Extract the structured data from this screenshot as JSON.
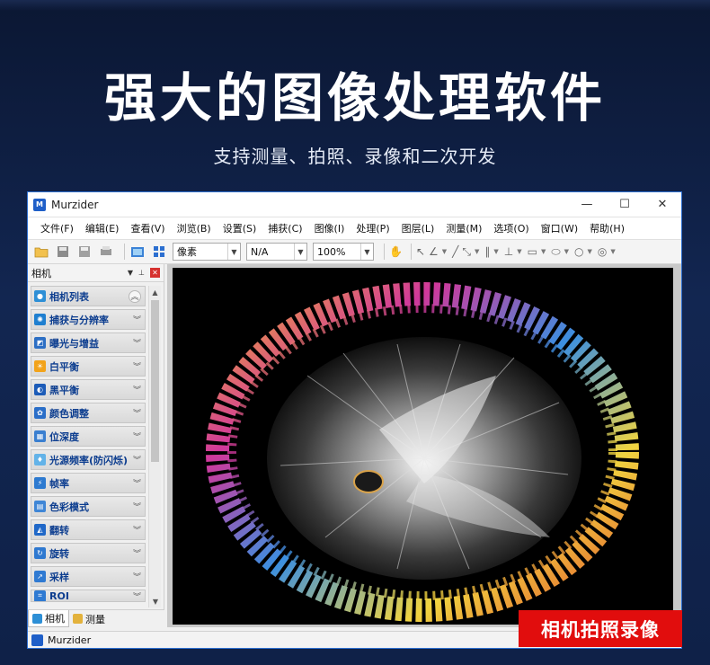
{
  "hero": {
    "title": "强大的图像处理软件",
    "subtitle": "支持测量、拍照、录像和二次开发"
  },
  "window": {
    "title": "Murzider",
    "controls": [
      "—",
      "☐",
      "✕"
    ]
  },
  "menu": [
    "文件(F)",
    "编辑(E)",
    "查看(V)",
    "浏览(B)",
    "设置(S)",
    "捕获(C)",
    "图像(I)",
    "处理(P)",
    "图层(L)",
    "测量(M)",
    "选项(O)",
    "窗口(W)",
    "帮助(H)"
  ],
  "toolbar": {
    "unit_select": "像素",
    "value_select": "N/A",
    "zoom_select": "100%"
  },
  "panel": {
    "title": "相机",
    "items": [
      {
        "label": "相机列表",
        "icon": "camera-icon",
        "color": "#2d8fd6"
      },
      {
        "label": "捕获与分辨率",
        "icon": "aperture-icon",
        "color": "#1e7fd0"
      },
      {
        "label": "曝光与增益",
        "icon": "exposure-icon",
        "color": "#2d6fc4"
      },
      {
        "label": "白平衡",
        "icon": "sun-icon",
        "color": "#f2a31b"
      },
      {
        "label": "黑平衡",
        "icon": "contrast-icon",
        "color": "#1d5cb8"
      },
      {
        "label": "颜色调整",
        "icon": "palette-icon",
        "color": "#2a6ec8"
      },
      {
        "label": "位深度",
        "icon": "bit-depth-icon",
        "color": "#3a7fd0"
      },
      {
        "label": "光源频率(防闪烁)",
        "icon": "bulb-icon",
        "color": "#63b3e8"
      },
      {
        "label": "帧率",
        "icon": "frame-rate-icon",
        "color": "#2d7ad0"
      },
      {
        "label": "色彩模式",
        "icon": "color-mode-icon",
        "color": "#3f86d6"
      },
      {
        "label": "翻转",
        "icon": "flip-icon",
        "color": "#2068c8"
      },
      {
        "label": "旋转",
        "icon": "rotate-icon",
        "color": "#2f79d0"
      },
      {
        "label": "采样",
        "icon": "sampling-icon",
        "color": "#2f7ad2"
      },
      {
        "label": "ROI",
        "icon": "roi-icon",
        "color": "#2f7ad2"
      }
    ],
    "tabs": [
      {
        "label": "相机",
        "icon": "camera-tab-icon"
      },
      {
        "label": "测量",
        "icon": "measure-tab-icon"
      }
    ]
  },
  "statusbar": {
    "text": "Murzider"
  },
  "badge": {
    "text": "相机拍照录像"
  }
}
